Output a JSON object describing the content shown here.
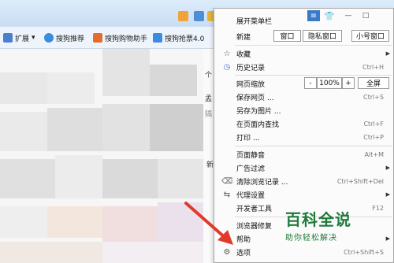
{
  "bookmarks": [
    {
      "label": "扩展",
      "color": "#4a7fd0"
    },
    {
      "label": "搜狗推荐",
      "color": "#3b8be0"
    },
    {
      "label": "搜狗购物助手",
      "color": "#e46a2e"
    },
    {
      "label": "搜狗抢票4.0",
      "color": "#3b8be0"
    }
  ],
  "page_snippets": [
    "个",
    "孟",
    "隔",
    "新"
  ],
  "menu": {
    "title": "展开菜单栏",
    "new_label": "新建",
    "new_buttons": [
      "窗口",
      "隐私窗口",
      "小号窗口"
    ],
    "items_group1": [
      {
        "label": "收藏",
        "shortcut": "",
        "arrow": "▶",
        "icon": "star-icon"
      },
      {
        "label": "历史记录",
        "shortcut": "Ctrl+H",
        "arrow": "",
        "icon": "clock-icon"
      }
    ],
    "zoom": {
      "label": "网页缩放",
      "minus": "-",
      "value": "100%",
      "plus": "+",
      "fullscreen": "全屏"
    },
    "items_group2": [
      {
        "label": "保存网页 ...",
        "shortcut": "Ctrl+S"
      },
      {
        "label": "另存为图片 ...",
        "shortcut": ""
      },
      {
        "label": "在页面内查找",
        "shortcut": "Ctrl+F"
      },
      {
        "label": "打印 ...",
        "shortcut": "Ctrl+P"
      }
    ],
    "items_group3": [
      {
        "label": "页面静音",
        "shortcut": "Alt+M",
        "arrow": ""
      },
      {
        "label": "广告过滤",
        "shortcut": "",
        "arrow": "▶"
      },
      {
        "label": "清除浏览记录 ...",
        "shortcut": "Ctrl+Shift+Del",
        "arrow": ""
      },
      {
        "label": "代理设置",
        "shortcut": "",
        "arrow": "▶"
      },
      {
        "label": "开发者工具",
        "shortcut": "F12",
        "arrow": ""
      }
    ],
    "items_group4": [
      {
        "label": "浏览器修复",
        "shortcut": "",
        "arrow": ""
      },
      {
        "label": "帮助",
        "shortcut": "",
        "arrow": "▶"
      },
      {
        "label": "选项",
        "shortcut": "Ctrl+Shift+S",
        "arrow": ""
      }
    ]
  },
  "watermark": {
    "title": "百科全说",
    "subtitle": "助你轻松解决"
  },
  "colors": {
    "arrow": "#e23a2a",
    "watermark": "#1f7a3a"
  }
}
